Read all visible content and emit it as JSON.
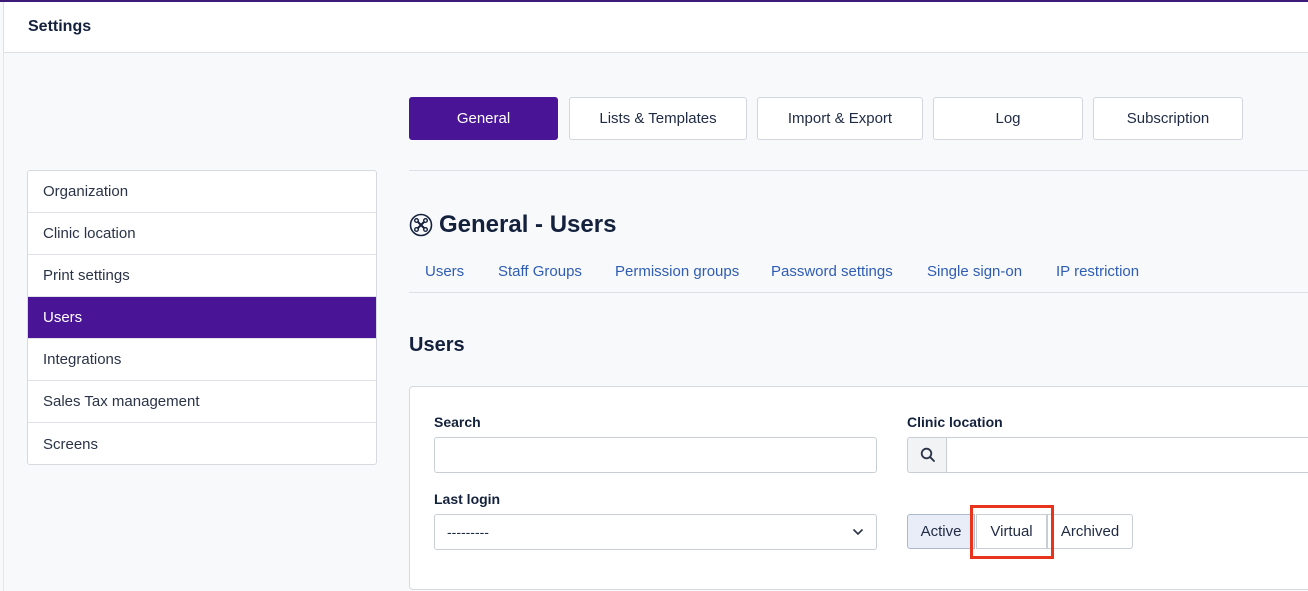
{
  "header": {
    "title": "Settings"
  },
  "top_tabs": [
    {
      "label": "General",
      "active": true
    },
    {
      "label": "Lists & Templates",
      "active": false
    },
    {
      "label": "Import & Export",
      "active": false
    },
    {
      "label": "Log",
      "active": false
    },
    {
      "label": "Subscription",
      "active": false
    }
  ],
  "sidebar": {
    "items": [
      {
        "label": "Organization",
        "active": false
      },
      {
        "label": "Clinic location",
        "active": false
      },
      {
        "label": "Print settings",
        "active": false
      },
      {
        "label": "Users",
        "active": true
      },
      {
        "label": "Integrations",
        "active": false
      },
      {
        "label": "Sales Tax management",
        "active": false
      },
      {
        "label": "Screens",
        "active": false
      }
    ]
  },
  "section": {
    "icon": "tools-icon",
    "title": "General - Users"
  },
  "subnav": {
    "links": [
      "Users",
      "Staff Groups",
      "Permission groups",
      "Password settings",
      "Single sign-on",
      "IP restriction"
    ]
  },
  "users": {
    "title": "Users",
    "search_label": "Search",
    "search_value": "",
    "clinic_location_label": "Clinic location",
    "clinic_location_value": "",
    "last_login_label": "Last login",
    "last_login_selected": "---------",
    "status_buttons": [
      {
        "label": "Active",
        "active": true
      },
      {
        "label": "Virtual",
        "active": false,
        "highlighted": true
      },
      {
        "label": "Archived",
        "active": false
      }
    ]
  },
  "colors": {
    "brand": "#4a1496",
    "link": "#2f5db5",
    "highlight": "#e8341c"
  }
}
